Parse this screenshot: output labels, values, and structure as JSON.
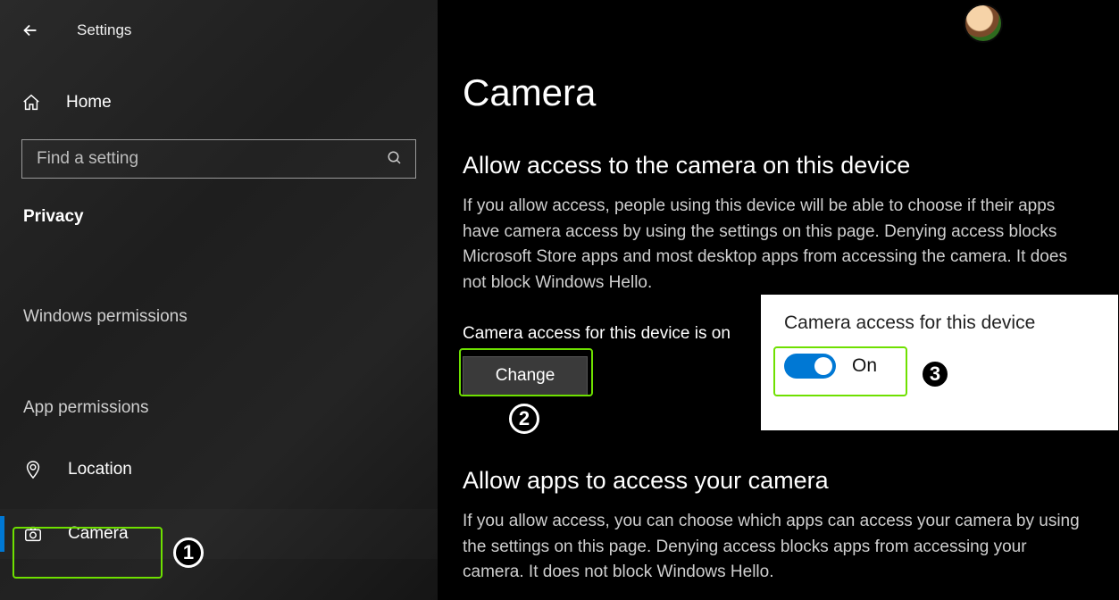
{
  "app_title": "Settings",
  "sidebar": {
    "home_label": "Home",
    "search_placeholder": "Find a setting",
    "section_label": "Privacy",
    "group1_label": "Windows permissions",
    "group2_label": "App permissions",
    "nav": {
      "location": {
        "label": "Location"
      },
      "camera": {
        "label": "Camera",
        "active": true
      }
    }
  },
  "main": {
    "page_title": "Camera",
    "section1": {
      "title": "Allow access to the camera on this device",
      "body": "If you allow access, people using this device will be able to choose if their apps have camera access by using the settings on this page. Denying access blocks Microsoft Store apps and most desktop apps from accessing the camera. It does not block Windows Hello.",
      "status_text": "Camera access for this device is on",
      "change_label": "Change"
    },
    "section2": {
      "title": "Allow apps to access your camera",
      "body": "If you allow access, you can choose which apps can access your camera by using the settings on this page. Denying access blocks apps from accessing your camera. It does not block Windows Hello."
    }
  },
  "popup": {
    "title": "Camera access for this device",
    "toggle_state": "On"
  },
  "callouts": {
    "one": "1",
    "two": "2",
    "three": "3"
  }
}
